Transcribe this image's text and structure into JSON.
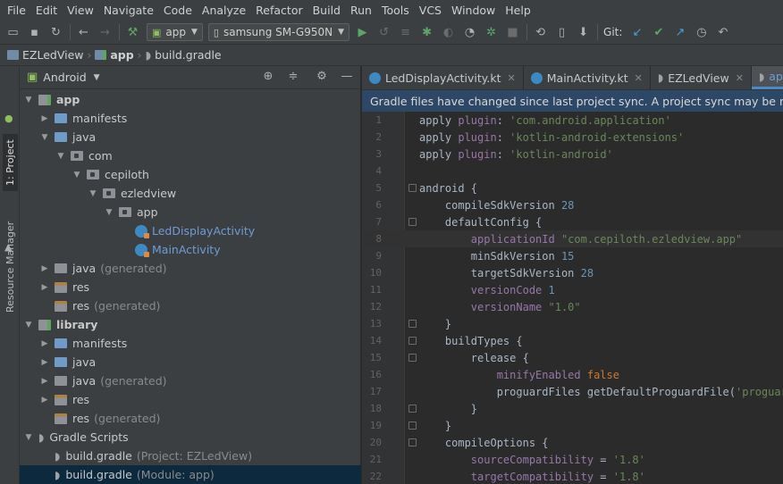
{
  "menu": [
    "File",
    "Edit",
    "View",
    "Navigate",
    "Code",
    "Analyze",
    "Refactor",
    "Build",
    "Run",
    "Tools",
    "VCS",
    "Window",
    "Help"
  ],
  "toolbar": {
    "run_config": "app",
    "device": "samsung SM-G950N",
    "git_label": "Git:"
  },
  "breadcrumb": [
    "EZLedView",
    "app",
    "build.gradle"
  ],
  "side_tabs": {
    "project": "1: Project",
    "resource_manager": "Resource Manager"
  },
  "project_panel": {
    "view_mode": "Android",
    "tree": [
      {
        "label": "app",
        "level": 0,
        "expanded": true,
        "icon": "module",
        "bold": true
      },
      {
        "label": "manifests",
        "level": 1,
        "expanded": false,
        "icon": "folder-blue"
      },
      {
        "label": "java",
        "level": 1,
        "expanded": true,
        "icon": "folder-blue"
      },
      {
        "label": "com",
        "level": 2,
        "expanded": true,
        "icon": "package"
      },
      {
        "label": "cepiloth",
        "level": 3,
        "expanded": true,
        "icon": "package"
      },
      {
        "label": "ezledview",
        "level": 4,
        "expanded": true,
        "icon": "package"
      },
      {
        "label": "app",
        "level": 5,
        "expanded": true,
        "icon": "package"
      },
      {
        "label": "LedDisplayActivity",
        "level": 6,
        "icon": "kotlin-class",
        "blue": true
      },
      {
        "label": "MainActivity",
        "level": 6,
        "icon": "kotlin-class",
        "blue": true
      },
      {
        "label": "java",
        "suffix": "(generated)",
        "level": 1,
        "expanded": false,
        "icon": "folder-gray"
      },
      {
        "label": "res",
        "level": 1,
        "expanded": false,
        "icon": "res"
      },
      {
        "label": "res",
        "suffix": "(generated)",
        "level": 1,
        "icon": "res"
      },
      {
        "label": "library",
        "level": 0,
        "expanded": true,
        "icon": "library",
        "bold": true
      },
      {
        "label": "manifests",
        "level": 1,
        "expanded": false,
        "icon": "folder-blue"
      },
      {
        "label": "java",
        "level": 1,
        "expanded": false,
        "icon": "folder-blue"
      },
      {
        "label": "java",
        "suffix": "(generated)",
        "level": 1,
        "expanded": false,
        "icon": "folder-gray"
      },
      {
        "label": "res",
        "level": 1,
        "expanded": false,
        "icon": "res"
      },
      {
        "label": "res",
        "suffix": "(generated)",
        "level": 1,
        "icon": "res"
      },
      {
        "label": "Gradle Scripts",
        "level": 0,
        "expanded": true,
        "icon": "gradle"
      },
      {
        "label": "build.gradle",
        "suffix": "(Project: EZLedView)",
        "level": 1,
        "icon": "gradle"
      },
      {
        "label": "build.gradle",
        "suffix": "(Module: app)",
        "level": 1,
        "icon": "gradle",
        "selected": true
      }
    ]
  },
  "editor": {
    "tabs": [
      {
        "label": "LedDisplayActivity.kt",
        "icon": "kotlin-class"
      },
      {
        "label": "MainActivity.kt",
        "icon": "kotlin-class"
      },
      {
        "label": "EZLedView",
        "icon": "gradle"
      },
      {
        "label": "app",
        "icon": "gradle",
        "active": true
      }
    ],
    "notification": "Gradle files have changed since last project sync. A project sync may be necessary for",
    "current_line": 8,
    "lines": [
      {
        "n": "1",
        "fold": false,
        "parts": [
          [
            "apply ",
            "plain"
          ],
          [
            "plugin",
            "purple"
          ],
          [
            ": ",
            "plain"
          ],
          [
            "'com.android.application'",
            "green"
          ]
        ]
      },
      {
        "n": "2",
        "fold": false,
        "parts": [
          [
            "apply ",
            "plain"
          ],
          [
            "plugin",
            "purple"
          ],
          [
            ": ",
            "plain"
          ],
          [
            "'kotlin-android-extensions'",
            "green"
          ]
        ]
      },
      {
        "n": "3",
        "fold": false,
        "parts": [
          [
            "apply ",
            "plain"
          ],
          [
            "plugin",
            "purple"
          ],
          [
            ": ",
            "plain"
          ],
          [
            "'kotlin-android'",
            "green"
          ]
        ]
      },
      {
        "n": "4",
        "fold": false,
        "parts": []
      },
      {
        "n": "5",
        "fold": true,
        "parts": [
          [
            "android {",
            "plain"
          ]
        ]
      },
      {
        "n": "6",
        "fold": false,
        "parts": [
          [
            "    compileSdkVersion ",
            "plain"
          ],
          [
            "28",
            "num"
          ]
        ]
      },
      {
        "n": "7",
        "fold": true,
        "parts": [
          [
            "    defaultConfig {",
            "plain"
          ]
        ]
      },
      {
        "n": "8",
        "fold": false,
        "parts": [
          [
            "        applicationId ",
            "purple"
          ],
          [
            "\"com.cepiloth.ezledview.app\"",
            "green"
          ]
        ]
      },
      {
        "n": "9",
        "fold": false,
        "parts": [
          [
            "        minSdkVersion ",
            "plain"
          ],
          [
            "15",
            "num"
          ]
        ]
      },
      {
        "n": "10",
        "fold": false,
        "parts": [
          [
            "        targetSdkVersion ",
            "plain"
          ],
          [
            "28",
            "num"
          ]
        ]
      },
      {
        "n": "11",
        "fold": false,
        "parts": [
          [
            "        versionCode ",
            "purple"
          ],
          [
            "1",
            "num"
          ]
        ]
      },
      {
        "n": "12",
        "fold": false,
        "parts": [
          [
            "        versionName ",
            "purple"
          ],
          [
            "\"1.0\"",
            "green"
          ]
        ]
      },
      {
        "n": "13",
        "fold": true,
        "parts": [
          [
            "    }",
            "plain"
          ]
        ]
      },
      {
        "n": "14",
        "fold": true,
        "parts": [
          [
            "    buildTypes {",
            "plain"
          ]
        ]
      },
      {
        "n": "15",
        "fold": true,
        "parts": [
          [
            "        release {",
            "plain"
          ]
        ]
      },
      {
        "n": "16",
        "fold": false,
        "parts": [
          [
            "            minifyEnabled ",
            "purple"
          ],
          [
            "false",
            "orange"
          ]
        ]
      },
      {
        "n": "17",
        "fold": false,
        "parts": [
          [
            "            proguardFiles getDefaultProguardFile(",
            "plain"
          ],
          [
            "'proguard-android.t",
            "green"
          ]
        ]
      },
      {
        "n": "18",
        "fold": true,
        "parts": [
          [
            "        }",
            "plain"
          ]
        ]
      },
      {
        "n": "19",
        "fold": true,
        "parts": [
          [
            "    }",
            "plain"
          ]
        ]
      },
      {
        "n": "20",
        "fold": true,
        "parts": [
          [
            "    compileOptions {",
            "plain"
          ]
        ]
      },
      {
        "n": "21",
        "fold": false,
        "parts": [
          [
            "        sourceCompatibility ",
            "purple"
          ],
          [
            "= ",
            "plain"
          ],
          [
            "'1.8'",
            "green"
          ]
        ]
      },
      {
        "n": "22",
        "fold": false,
        "parts": [
          [
            "        targetCompatibility ",
            "purple"
          ],
          [
            "= ",
            "plain"
          ],
          [
            "'1.8'",
            "green"
          ]
        ]
      }
    ]
  },
  "colors": {
    "accent": "#4a88c7",
    "selection": "#0d293e",
    "notification_bg": "#2d4766"
  }
}
